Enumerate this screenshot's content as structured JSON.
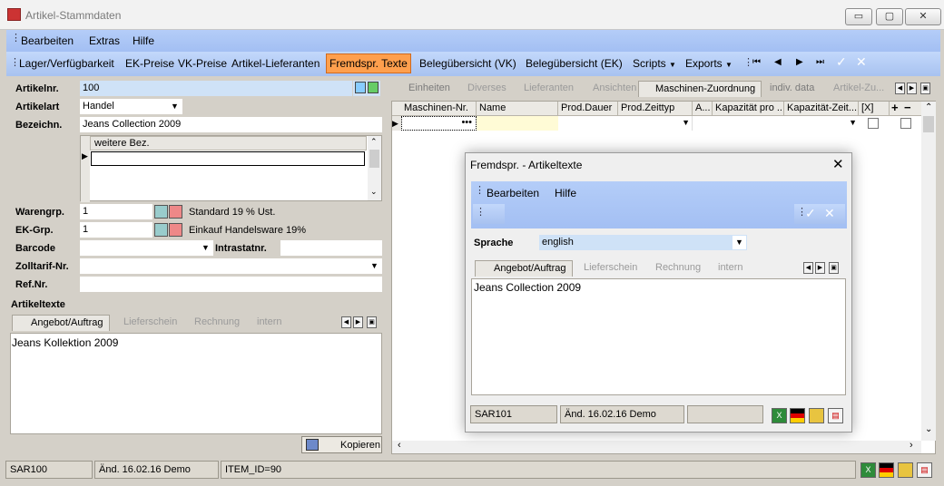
{
  "window": {
    "title": "Artikel-Stammdaten",
    "minimize": "▭",
    "maximize": "▢",
    "close": "✕"
  },
  "menu": [
    "Bearbeiten",
    "Extras",
    "Hilfe"
  ],
  "toolbar": {
    "items": [
      "Lager/Verfügbarkeit",
      "EK-Preise",
      "VK-Preise",
      "Artikel-Lieferanten",
      "Fremdspr. Texte",
      "Belegübersicht (VK)",
      "Belegübersicht (EK)",
      "Scripts",
      "Exports"
    ],
    "active": "Fremdspr. Texte",
    "nav": [
      "⏮",
      "◀",
      "▶",
      "⏭",
      "✓",
      "✕"
    ]
  },
  "form": {
    "artikelnr": {
      "label": "Artikelnr.",
      "value": "100"
    },
    "artikelart": {
      "label": "Artikelart",
      "value": "Handel"
    },
    "bezeichn": {
      "label": "Bezeichn.",
      "value": "Jeans Collection 2009"
    },
    "weitere_bez": {
      "header": "weitere Bez."
    },
    "warengrp": {
      "label": "Warengrp.",
      "value": "1",
      "desc": "Standard 19 % Ust."
    },
    "ekgrp": {
      "label": "EK-Grp.",
      "value": "1",
      "desc": "Einkauf Handelsware 19%"
    },
    "barcode": {
      "label": "Barcode",
      "value": ""
    },
    "intrastat": {
      "label": "Intrastatnr.",
      "value": ""
    },
    "zolltarif": {
      "label": "Zolltarif-Nr.",
      "value": ""
    },
    "refnr": {
      "label": "Ref.Nr.",
      "value": ""
    },
    "artikeltexte": {
      "label": "Artikeltexte"
    }
  },
  "left_text_tabs": [
    "Angebot/Auftrag",
    "Lieferschein",
    "Rechnung",
    "intern"
  ],
  "left_text": "Jeans Kollektion 2009",
  "kopieren": "Kopieren",
  "right_tabs": [
    "Einheiten",
    "Diverses",
    "Lieferanten",
    "Ansichten",
    "Maschinen-Zuordnung",
    "indiv. data",
    "Artikel-Zu..."
  ],
  "right_active_tab": "Maschinen-Zuordnung",
  "grid_columns": [
    "Maschinen-Nr.",
    "Name",
    "Prod.Dauer",
    "Prod.Zeittyp",
    "A...",
    "Kapazität pro ...",
    "Kapazität-Zeit...",
    "[X]"
  ],
  "grid_add": "+",
  "grid_remove": "−",
  "status": {
    "code": "SAR100",
    "changed": "Änd. 16.02.16 Demo",
    "item": "ITEM_ID=90"
  },
  "dialog": {
    "title": "Fremdspr. - Artikeltexte",
    "menu": [
      "Bearbeiten",
      "Hilfe"
    ],
    "sprache_label": "Sprache",
    "sprache_value": "english",
    "tabs": [
      "Angebot/Auftrag",
      "Lieferschein",
      "Rechnung",
      "intern"
    ],
    "text": "Jeans Collection 2009",
    "status": {
      "code": "SAR101",
      "changed": "Änd. 16.02.16 Demo",
      "empty": ""
    }
  },
  "colors": {
    "menubar": "#a9c4f5",
    "active_toolbar": "#ff9f4d",
    "field_blue": "#cfe2f7",
    "panel": "#d4d0c8"
  }
}
